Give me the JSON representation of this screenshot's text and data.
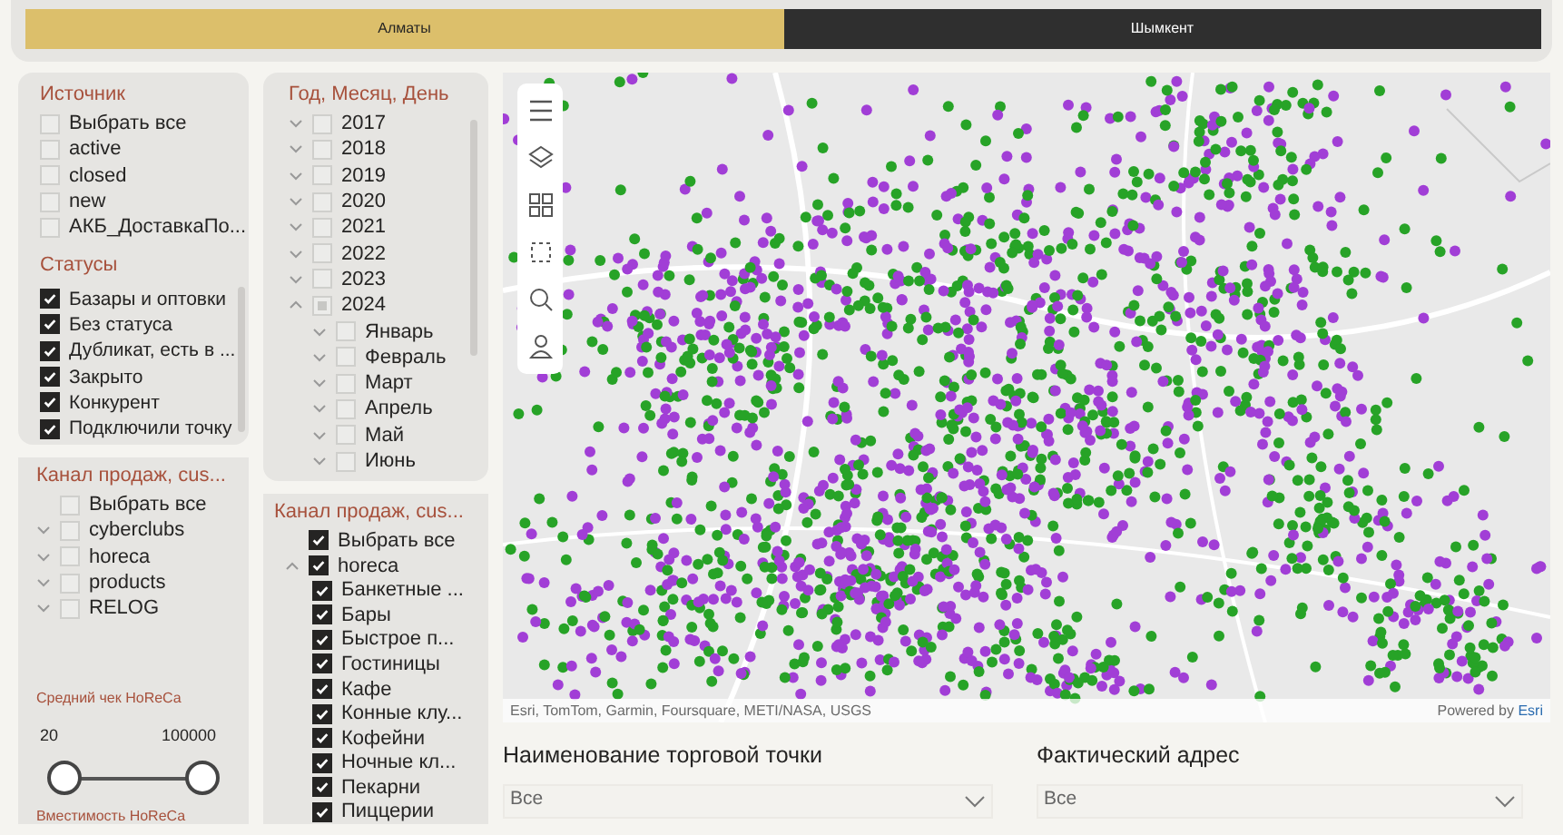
{
  "tabs": [
    {
      "label": "Алматы",
      "selected": true
    },
    {
      "label": "Шымкент",
      "selected": false
    }
  ],
  "source_filter": {
    "title": "Источник",
    "items": [
      {
        "label": "Выбрать все",
        "checked": false
      },
      {
        "label": "active",
        "checked": false
      },
      {
        "label": "closed",
        "checked": false
      },
      {
        "label": "new",
        "checked": false
      },
      {
        "label": "АКБ_ДоставкаПо...",
        "checked": false
      }
    ]
  },
  "status_filter": {
    "title": "Статусы",
    "items": [
      {
        "label": "Базары и оптовки",
        "checked": true
      },
      {
        "label": "Без статуса",
        "checked": true
      },
      {
        "label": "Дубликат, есть в ...",
        "checked": true
      },
      {
        "label": "Закрыто",
        "checked": true
      },
      {
        "label": "Конкурент",
        "checked": true
      },
      {
        "label": "Подключили точку",
        "checked": true
      }
    ]
  },
  "channel_filter_1": {
    "title": "Канал продаж, cus...",
    "items": [
      {
        "label": "Выбрать все",
        "kind": "select_all",
        "checked": false
      },
      {
        "label": "cyberclubs",
        "kind": "node",
        "checked": false,
        "expanded": false
      },
      {
        "label": "horeca",
        "kind": "node",
        "checked": false,
        "expanded": false
      },
      {
        "label": "products",
        "kind": "node",
        "checked": false,
        "expanded": false
      },
      {
        "label": "RELOG",
        "kind": "node",
        "checked": false,
        "expanded": false
      }
    ]
  },
  "avg_check_slider": {
    "title": "Средний чек HoReCa",
    "min_value": "20",
    "max_value": "100000",
    "thumbs": [
      {
        "level": 0
      },
      {
        "level": 1
      }
    ]
  },
  "capacity_slider": {
    "title": "Вместимость HoReCa"
  },
  "date_filter": {
    "title": "Год, Месяц, День",
    "items": [
      {
        "label": "2017",
        "kind": "node",
        "checked": false,
        "partial": false,
        "expanded": false
      },
      {
        "label": "2018",
        "kind": "node",
        "checked": false,
        "partial": false,
        "expanded": false
      },
      {
        "label": "2019",
        "kind": "node",
        "checked": false,
        "partial": false,
        "expanded": false
      },
      {
        "label": "2020",
        "kind": "node",
        "checked": false,
        "partial": false,
        "expanded": false
      },
      {
        "label": "2021",
        "kind": "node",
        "checked": false,
        "partial": false,
        "expanded": false
      },
      {
        "label": "2022",
        "kind": "node",
        "checked": false,
        "partial": false,
        "expanded": false
      },
      {
        "label": "2023",
        "kind": "node",
        "checked": false,
        "partial": false,
        "expanded": false
      },
      {
        "label": "2024",
        "kind": "node",
        "checked": false,
        "partial": true,
        "expanded": true,
        "children": [
          {
            "label": "Январь",
            "kind": "node",
            "checked": false,
            "partial": false,
            "expanded": false
          },
          {
            "label": "Февраль",
            "kind": "node",
            "checked": false,
            "partial": false,
            "expanded": false
          },
          {
            "label": "Март",
            "kind": "node",
            "checked": false,
            "partial": false,
            "expanded": false
          },
          {
            "label": "Апрель",
            "kind": "node",
            "checked": false,
            "partial": false,
            "expanded": false
          },
          {
            "label": "Май",
            "kind": "node",
            "checked": false,
            "partial": false,
            "expanded": false
          },
          {
            "label": "Июнь",
            "kind": "node",
            "checked": false,
            "partial": false,
            "expanded": false
          }
        ]
      }
    ]
  },
  "channel_filter_2": {
    "title": "Канал продаж, cus...",
    "items": [
      {
        "label": "Выбрать все",
        "kind": "select_all",
        "checked": true
      },
      {
        "label": "horeca",
        "kind": "node",
        "checked": true,
        "expanded": true,
        "children": [
          {
            "label": "Банкетные ...",
            "kind": "leaf",
            "checked": true
          },
          {
            "label": "Бары",
            "kind": "leaf",
            "checked": true
          },
          {
            "label": "Быстрое п...",
            "kind": "leaf",
            "checked": true
          },
          {
            "label": "Гостиницы",
            "kind": "leaf",
            "checked": true
          },
          {
            "label": "Кафе",
            "kind": "leaf",
            "checked": true
          },
          {
            "label": "Конные клу...",
            "kind": "leaf",
            "checked": true
          },
          {
            "label": "Кофейни",
            "kind": "leaf",
            "checked": true
          },
          {
            "label": "Ночные кл...",
            "kind": "leaf",
            "checked": true
          },
          {
            "label": "Пекарни",
            "kind": "leaf",
            "checked": true
          },
          {
            "label": "Пиццерии",
            "kind": "leaf",
            "checked": true
          }
        ]
      }
    ]
  },
  "map": {
    "attribution": "Esri, TomTom, Garmin, Foursquare, METI/NASA, USGS",
    "powered_by": "Powered by",
    "powered_link": "Esri"
  },
  "dropdowns": [
    {
      "label": "Наименование торговой точки",
      "value": "Все"
    },
    {
      "label": "Фактический адрес",
      "value": "Все"
    }
  ]
}
